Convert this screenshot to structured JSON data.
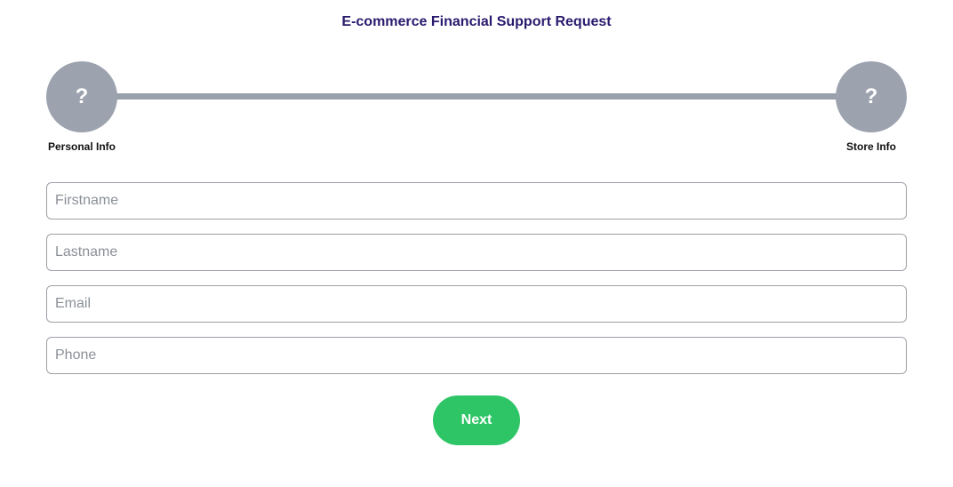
{
  "form": {
    "title": "E-commerce Financial Support Request",
    "fields": [
      {
        "placeholder": "Firstname",
        "value": ""
      },
      {
        "placeholder": "Lastname",
        "value": ""
      },
      {
        "placeholder": "Email",
        "value": ""
      },
      {
        "placeholder": "Phone",
        "value": ""
      }
    ],
    "next_label": "Next"
  },
  "stepper": {
    "steps": [
      {
        "label": "Personal Info",
        "icon": "question-icon",
        "symbol": "?"
      },
      {
        "label": "Store Info",
        "icon": "question-icon",
        "symbol": "?"
      }
    ]
  },
  "colors": {
    "title": "#2a1a6e",
    "step_inactive": "#9ca3af",
    "connector": "#9aa0ab",
    "primary_button": "#2ec566"
  }
}
